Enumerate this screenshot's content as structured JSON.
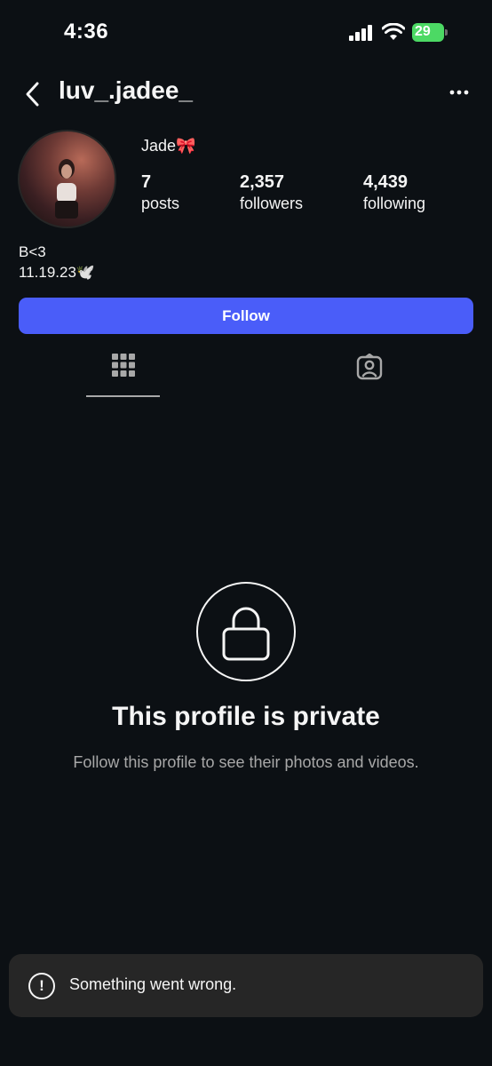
{
  "status_bar": {
    "time": "4:36",
    "battery": "29"
  },
  "header": {
    "username": "luv_.jadee_",
    "back_icon": "chevron-left-icon",
    "more_icon": "ellipsis-icon"
  },
  "profile": {
    "display_name": "Jade🎀",
    "stats": [
      {
        "value": "7",
        "label": "posts"
      },
      {
        "value": "2,357",
        "label": "followers"
      },
      {
        "value": "4,439",
        "label": "following"
      }
    ],
    "bio_line1": "B<3",
    "bio_line2": "11.19.23🕊️",
    "follow_label": "Follow"
  },
  "tabs": [
    {
      "icon": "grid-icon",
      "active": true
    },
    {
      "icon": "tagged-person-icon",
      "active": false
    }
  ],
  "private": {
    "title": "This profile is private",
    "subtitle": "Follow this profile to see their photos and videos."
  },
  "toast": {
    "icon_glyph": "!",
    "message": "Something went wrong."
  },
  "colors": {
    "background": "#0c1014",
    "follow_button": "#4a5df9",
    "toast_background": "#262626",
    "battery": "#4cd964"
  }
}
